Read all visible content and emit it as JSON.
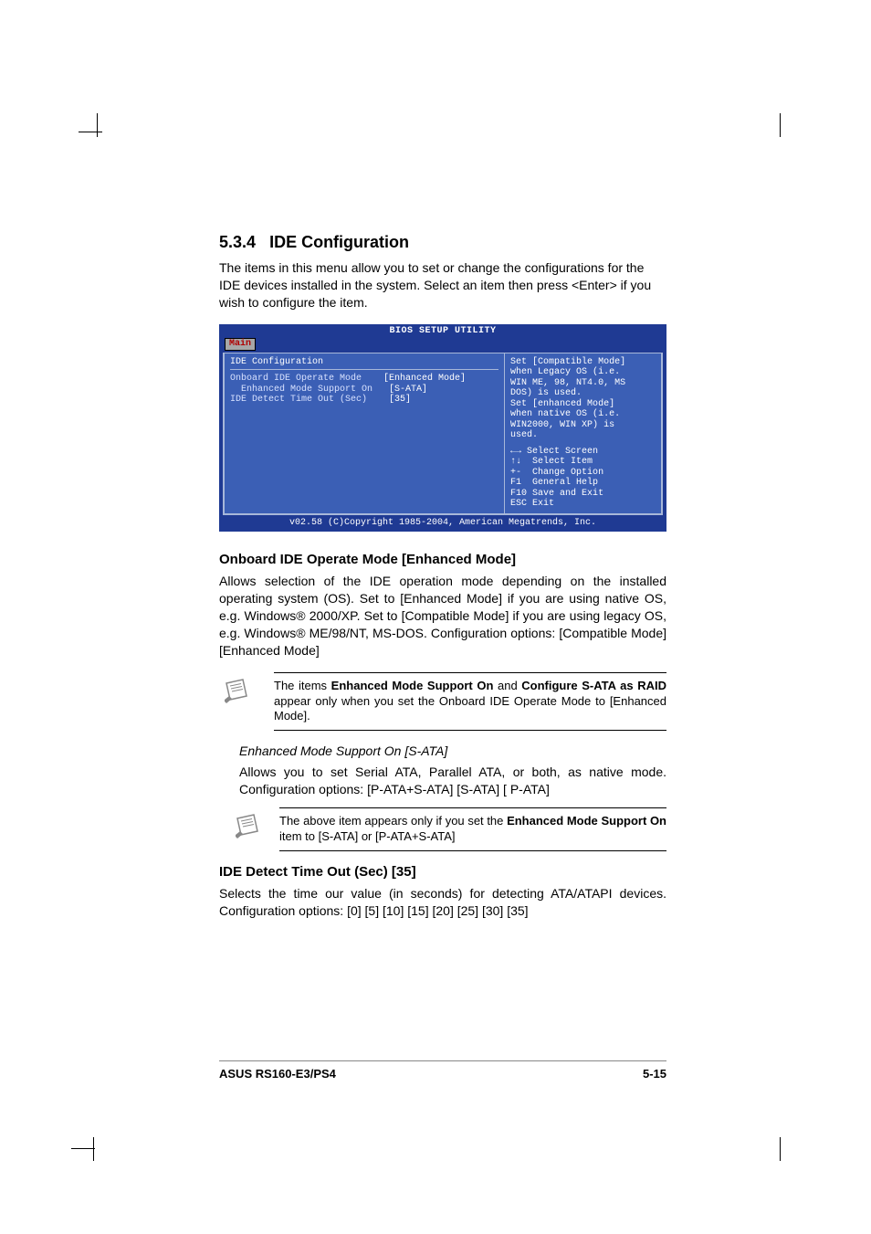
{
  "section": {
    "number": "5.3.4",
    "title": "IDE Configuration",
    "intro": "The items in this menu allow you to set or change the configurations for the IDE devices installed in the system. Select an item then press <Enter> if you wish to configure the item."
  },
  "bios": {
    "title": "BIOS SETUP UTILITY",
    "tab": "Main",
    "panel_title": "IDE Configuration",
    "rows": [
      {
        "label": "Onboard IDE Operate Mode",
        "value": "[Enhanced Mode]"
      },
      {
        "label": "  Enhanced Mode Support On",
        "value": "[S-ATA]"
      },
      {
        "label": "IDE Detect Time Out (Sec)",
        "value": "[35]"
      }
    ],
    "help": [
      "Set [Compatible Mode]",
      "when Legacy OS (i.e.",
      "WIN ME, 98, NT4.0, MS",
      "DOS) is used.",
      "",
      "Set [enhanced Mode]",
      "when native OS (i.e.",
      "WIN2000, WIN XP) is",
      "used."
    ],
    "nav": [
      "←→ Select Screen",
      "↑↓  Select Item",
      "+-  Change Option",
      "F1  General Help",
      "F10 Save and Exit",
      "ESC Exit"
    ],
    "footer": "v02.58 (C)Copyright 1985-2004, American Megatrends, Inc."
  },
  "onboard": {
    "heading": "Onboard IDE Operate Mode [Enhanced Mode]",
    "para": "Allows selection of the IDE operation mode depending on the installed operating system (OS). Set to [Enhanced Mode] if you are using native OS, e.g. Windows® 2000/XP. Set to [Compatible Mode] if you are using legacy OS, e.g. Windows® ME/98/NT, MS-DOS.  Configuration options: [Compatible Mode] [Enhanced Mode]"
  },
  "note1": {
    "pre": "The items ",
    "b1": "Enhanced Mode Support On",
    "mid": " and ",
    "b2": "Configure S-ATA as RAID",
    "post": " appear only when you set the Onboard IDE Operate Mode to [Enhanced Mode]."
  },
  "enhanced": {
    "title": "Enhanced Mode Support On [S-ATA]",
    "para": "Allows you to set Serial ATA, Parallel ATA, or both, as native mode. Configuration options: [P-ATA+S-ATA] [S-ATA] [ P-ATA]"
  },
  "note2": {
    "pre": "The above item appears only if you set the ",
    "b1": "Enhanced Mode Support On",
    "post": " item to [S-ATA] or [P-ATA+S-ATA]"
  },
  "detect": {
    "heading": "IDE Detect Time Out (Sec) [35]",
    "para": "Selects the time our value (in seconds) for detecting ATA/ATAPI devices. Configuration options: [0] [5] [10] [15] [20] [25] [30] [35]"
  },
  "footer": {
    "left": "ASUS RS160-E3/PS4",
    "right": "5-15"
  }
}
